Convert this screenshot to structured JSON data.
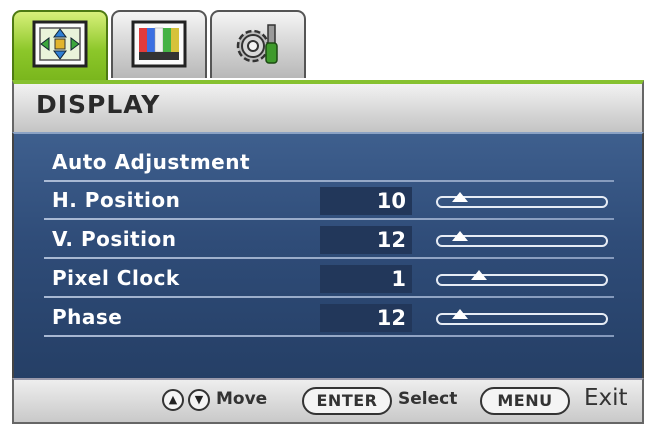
{
  "tabs": [
    {
      "name": "display-tab",
      "icon": "arrows-move-icon",
      "active": true
    },
    {
      "name": "picture-tab",
      "icon": "color-bars-icon",
      "active": false
    },
    {
      "name": "system-tab",
      "icon": "gear-screwdriver-icon",
      "active": false
    }
  ],
  "header": {
    "title": "DISPLAY"
  },
  "menu": {
    "auto_adjustment": "Auto Adjustment",
    "items": [
      {
        "label": "H. Position",
        "value": "10",
        "level": 0.14
      },
      {
        "label": "V. Position",
        "value": "12",
        "level": 0.14
      },
      {
        "label": "Pixel Clock",
        "value": "1",
        "level": 0.25
      },
      {
        "label": "Phase",
        "value": "12",
        "level": 0.14
      }
    ]
  },
  "footer": {
    "move_label": "Move",
    "enter_label": "ENTER",
    "select_label": "Select",
    "menu_label": "MENU",
    "exit_label": "Exit"
  },
  "colors": {
    "accent_green": "#86c130",
    "panel_blue": "#2f4c78",
    "value_box": "#22375a"
  }
}
